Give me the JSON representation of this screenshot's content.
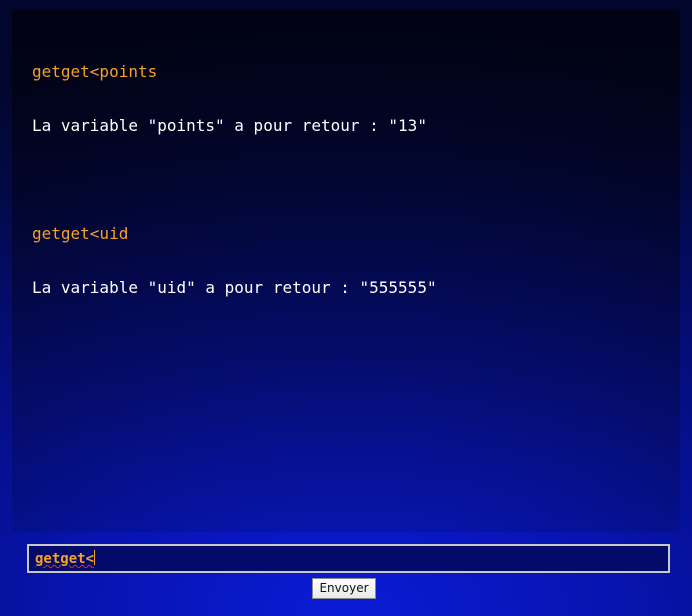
{
  "console": {
    "entries": [
      {
        "command": "getget<points",
        "response": "La variable \"points\" a pour retour : \"13\""
      },
      {
        "command": "getget<uid",
        "response": "La variable \"uid\" a pour retour : \"555555\""
      }
    ]
  },
  "input": {
    "value": "getget<"
  },
  "send_button": {
    "label": "Envoyer"
  },
  "colors": {
    "command": "#f5a02a",
    "response": "#ffffff",
    "background": "#050d7a"
  }
}
